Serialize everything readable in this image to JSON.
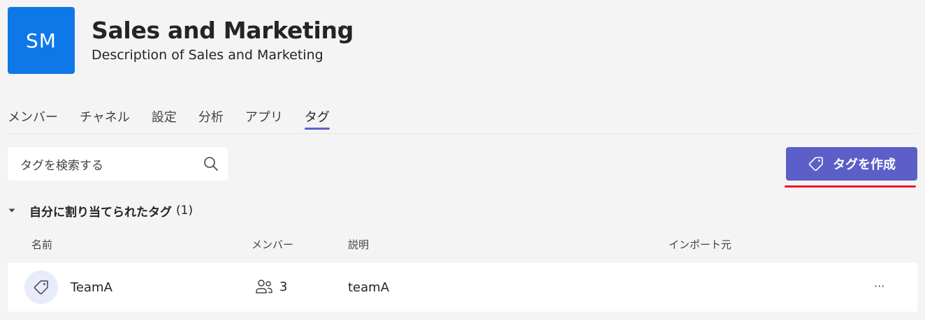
{
  "team": {
    "avatar_initials": "SM",
    "avatar_color": "#0f78e8",
    "name": "Sales and Marketing",
    "description": "Description of Sales and Marketing",
    "more_label": "···"
  },
  "tabs": [
    {
      "label": "メンバー",
      "active": false
    },
    {
      "label": "チャネル",
      "active": false
    },
    {
      "label": "設定",
      "active": false
    },
    {
      "label": "分析",
      "active": false
    },
    {
      "label": "アプリ",
      "active": false
    },
    {
      "label": "タグ",
      "active": true
    }
  ],
  "search": {
    "placeholder": "タグを検索する",
    "icon": "search-icon"
  },
  "create_button": {
    "label": "タグを作成",
    "icon": "tag-icon",
    "color": "#5b5fc7"
  },
  "highlight_color": "#e8182b",
  "section": {
    "title": "自分に割り当てられたタグ",
    "count": "(1)",
    "expanded": true
  },
  "columns": {
    "name": "名前",
    "members": "メンバー",
    "description": "説明",
    "import_source": "インポート元"
  },
  "rows": [
    {
      "name": "TeamA",
      "icon": "tag-icon",
      "members_icon": "people-icon",
      "members": "3",
      "description": "teamA",
      "import_source": "",
      "more_label": "···"
    }
  ]
}
